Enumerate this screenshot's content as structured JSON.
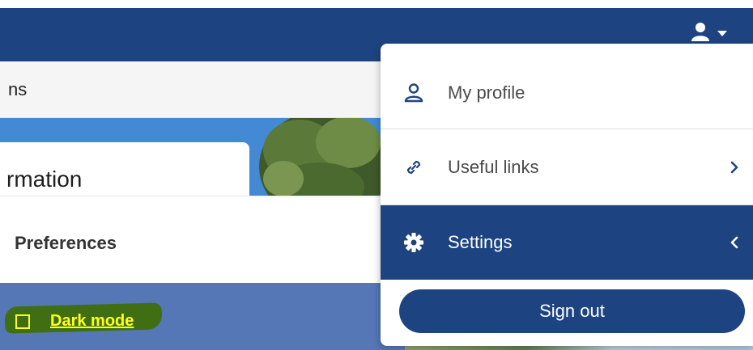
{
  "header": {
    "user_icon": "user-icon",
    "caret_icon": "caret-down-icon",
    "background_color": "#1d4480"
  },
  "subbar": {
    "text": "ns"
  },
  "hero": {
    "card_title": "rmation"
  },
  "preferences": {
    "title": "Preferences",
    "dark_mode": {
      "label": "Dark mode",
      "checked": false,
      "text_color": "#ffff22",
      "row_color": "#5577b5"
    }
  },
  "user_menu": {
    "items": [
      {
        "label": "My profile",
        "icon": "profile-icon"
      },
      {
        "label": "Useful links",
        "icon": "link-icon",
        "chevron": "chevron-right-icon"
      },
      {
        "label": "Settings",
        "icon": "gear-icon",
        "chevron": "chevron-left-icon",
        "active": true
      }
    ],
    "sign_out_label": "Sign out",
    "accent_color": "#1d4480"
  }
}
